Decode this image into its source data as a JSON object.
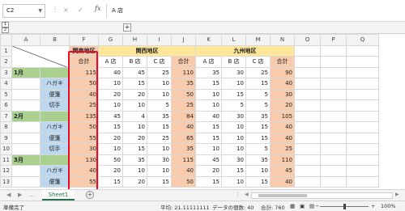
{
  "formula_bar": {
    "name_box": "C2",
    "fx": "fx",
    "cancel_icon": "×",
    "confirm_icon": "✓",
    "content": "A 店"
  },
  "outline": {
    "plus": "+",
    "level1": "1",
    "level2": "2"
  },
  "columns": [
    "A",
    "B",
    "F",
    "G",
    "H",
    "I",
    "J",
    "K",
    "L",
    "M",
    "N",
    "O",
    "P",
    "Q"
  ],
  "rows": [
    {
      "num": "1",
      "a": "",
      "b": "",
      "f": "関東地区",
      "g": "関西地区",
      "k": "九州地区"
    },
    {
      "num": "2",
      "a": "",
      "b": "",
      "f": "合計",
      "g": "A 店",
      "h": "B 店",
      "i": "C 店",
      "j": "合計",
      "k": "A 店",
      "l": "B 店",
      "m": "C 店",
      "n": "合計"
    },
    {
      "num": "3",
      "a": "1月",
      "b": "",
      "f": "115",
      "g": "40",
      "h": "45",
      "i": "25",
      "j": "110",
      "k": "35",
      "l": "30",
      "m": "25",
      "n": "90"
    },
    {
      "num": "4",
      "a": "",
      "b": "ハガキ",
      "f": "50",
      "g": "10",
      "h": "15",
      "i": "10",
      "j": "35",
      "k": "15",
      "l": "10",
      "m": "15",
      "n": "40"
    },
    {
      "num": "5",
      "a": "",
      "b": "便箋",
      "f": "40",
      "g": "20",
      "h": "20",
      "i": "10",
      "j": "50",
      "k": "10",
      "l": "15",
      "m": "5",
      "n": "30"
    },
    {
      "num": "6",
      "a": "",
      "b": "切手",
      "f": "25",
      "g": "10",
      "h": "10",
      "i": "5",
      "j": "25",
      "k": "10",
      "l": "5",
      "m": "5",
      "n": "20"
    },
    {
      "num": "7",
      "a": "2月",
      "b": "",
      "f": "135",
      "g": "45",
      "h": "4",
      "i": "35",
      "j": "84",
      "k": "40",
      "l": "30",
      "m": "35",
      "n": "105"
    },
    {
      "num": "8",
      "a": "",
      "b": "ハガキ",
      "f": "50",
      "g": "15",
      "h": "10",
      "i": "15",
      "j": "40",
      "k": "15",
      "l": "10",
      "m": "15",
      "n": "40"
    },
    {
      "num": "9",
      "a": "",
      "b": "便箋",
      "f": "55",
      "g": "20",
      "h": "20",
      "i": "25",
      "j": "65",
      "k": "15",
      "l": "10",
      "m": "15",
      "n": "40"
    },
    {
      "num": "10",
      "a": "",
      "b": "切手",
      "f": "30",
      "g": "10",
      "h": "15",
      "i": "10",
      "j": "35",
      "k": "10",
      "l": "10",
      "m": "5",
      "n": "25"
    },
    {
      "num": "11",
      "a": "3月",
      "b": "",
      "f": "130",
      "g": "50",
      "h": "35",
      "i": "30",
      "j": "115",
      "k": "45",
      "l": "30",
      "m": "35",
      "n": "110"
    },
    {
      "num": "12",
      "a": "",
      "b": "ハガキ",
      "f": "40",
      "g": "20",
      "h": "10",
      "i": "10",
      "j": "40",
      "k": "20",
      "l": "15",
      "m": "10",
      "n": "45"
    },
    {
      "num": "13",
      "a": "",
      "b": "便箋",
      "f": "55",
      "g": "15",
      "h": "20",
      "i": "15",
      "j": "50",
      "k": "15",
      "l": "10",
      "m": "15",
      "n": "40"
    }
  ],
  "sheet_tab": "Sheet1",
  "status": {
    "ready": "準備完了",
    "average": "平均: 21.11111111",
    "count": "データの個数: 40",
    "sum": "合計: 760",
    "zoom": "100%"
  },
  "colors": {
    "highlight_border": "#e0102a",
    "orange": "#f8cbad",
    "yellow": "#ffe699",
    "green": "#a9d08e",
    "blue": "#bdd7ee"
  }
}
